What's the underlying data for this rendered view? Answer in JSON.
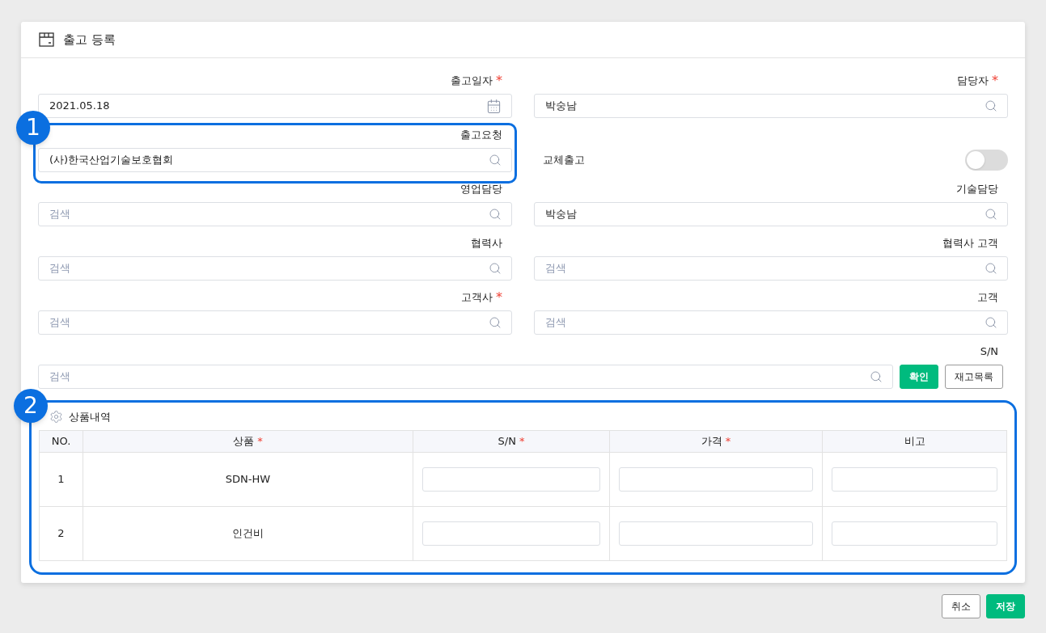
{
  "header": {
    "title": "출고 등록"
  },
  "fields": [
    {
      "kind": "date",
      "label": "출고일자",
      "required_mark": "*",
      "value": "2021.05.18"
    },
    {
      "kind": "search",
      "label": "담당자",
      "required_mark": "*",
      "value": "박숭남"
    },
    {
      "kind": "search",
      "label": "출고요청",
      "value": "(사)한국산업기술보호협회",
      "callout": "1"
    },
    {
      "kind": "toggle",
      "label": "교체출고",
      "on": false
    },
    {
      "kind": "search",
      "label": "영업담당",
      "placeholder": "검색"
    },
    {
      "kind": "search",
      "label": "기술담당",
      "value": "박숭남"
    },
    {
      "kind": "search",
      "label": "협력사",
      "placeholder": "검색"
    },
    {
      "kind": "search",
      "label": "협력사 고객",
      "placeholder": "검색"
    },
    {
      "kind": "search",
      "label": "고객사",
      "required_mark": "*",
      "placeholder": "검색"
    },
    {
      "kind": "search",
      "label": "고객",
      "placeholder": "검색"
    }
  ],
  "sn": {
    "label": "S/N",
    "placeholder": "검색",
    "buttons": [
      {
        "label": "확인",
        "kind": "primary"
      },
      {
        "label": "재고목록",
        "kind": "secondary"
      }
    ]
  },
  "products": {
    "callout": "2",
    "title": "상품내역",
    "columns": [
      {
        "label": "NO."
      },
      {
        "label": "상품",
        "required_mark": "*"
      },
      {
        "label": "S/N",
        "required_mark": "*"
      },
      {
        "label": "가격",
        "required_mark": "*"
      },
      {
        "label": "비고"
      }
    ],
    "rows": [
      {
        "no": "1",
        "product": "SDN-HW"
      },
      {
        "no": "2",
        "product": "인건비"
      }
    ]
  },
  "footer": {
    "buttons": [
      {
        "label": "취소",
        "kind": "secondary"
      },
      {
        "label": "저장",
        "kind": "primary"
      }
    ]
  }
}
